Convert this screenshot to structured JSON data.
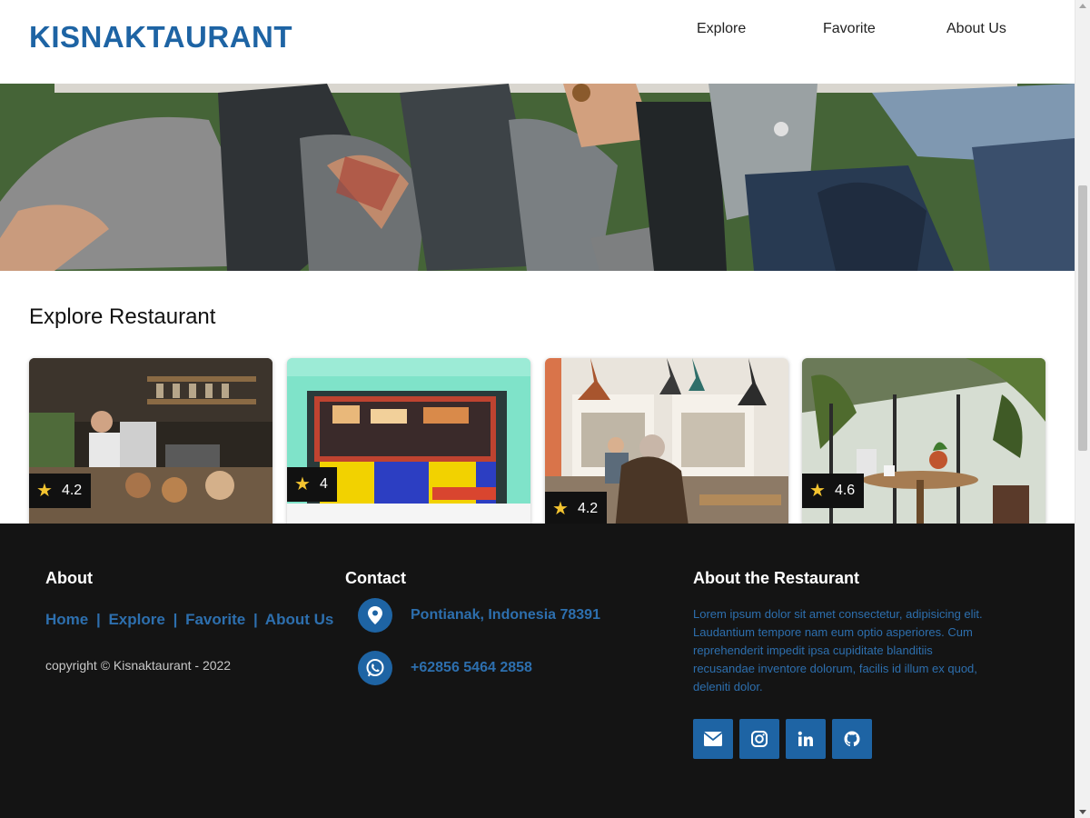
{
  "header": {
    "brand": "KISNAKTAURANT",
    "nav": [
      "Explore",
      "Favorite",
      "About Us"
    ]
  },
  "hero": {
    "image": "hero-image"
  },
  "explore": {
    "title": "Explore Restaurant",
    "cards": [
      {
        "rating": "4.2",
        "image": "restaurant-image-1"
      },
      {
        "rating": "4",
        "image": "restaurant-image-2"
      },
      {
        "rating": "4.2",
        "image": "restaurant-image-3"
      },
      {
        "rating": "4.6",
        "image": "restaurant-image-4"
      }
    ]
  },
  "footer": {
    "about": {
      "heading": "About",
      "links": [
        "Home",
        "Explore",
        "Favorite",
        "About Us"
      ],
      "separator": "|",
      "copyright": "copyright © Kisnaktaurant - 2022"
    },
    "contact": {
      "heading": "Contact",
      "address": "Pontianak, Indonesia 78391",
      "phone": "+62856 5464 2858",
      "icons": [
        "location-pin-icon",
        "whatsapp-icon"
      ]
    },
    "restaurant": {
      "heading": "About the Restaurant",
      "text": "Lorem ipsum dolor sit amet consectetur, adipisicing elit. Laudantium tempore nam eum optio asperiores. Cum reprehenderit impedit ipsa cupiditate blanditiis recusandae inventore dolorum, facilis id illum ex quod, deleniti dolor.",
      "socials": [
        "email-icon",
        "instagram-icon",
        "linkedin-icon",
        "github-icon"
      ]
    }
  },
  "colors": {
    "brand": "#1e64a4",
    "link": "#2d6fae",
    "footer_bg": "#141414",
    "star": "#f4c430"
  }
}
